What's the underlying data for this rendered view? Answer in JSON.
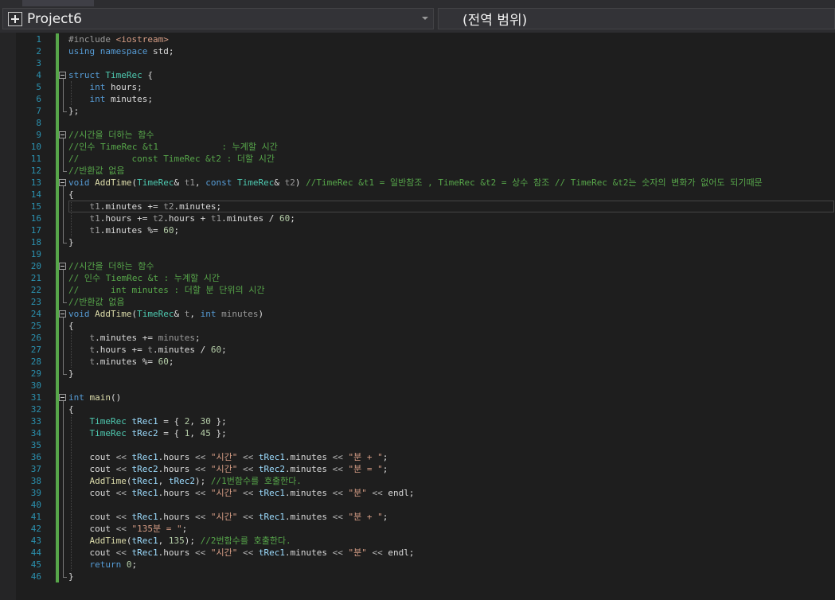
{
  "navbar": {
    "project": "Project6",
    "scope": "(전역 범위)"
  },
  "editor": {
    "caret_line": 15,
    "lines": [
      {
        "n": "1",
        "t": [
          [
            "pp",
            "#include "
          ],
          [
            "st",
            "<iostream>"
          ]
        ]
      },
      {
        "n": "2",
        "t": [
          [
            "kw",
            "using"
          ],
          [
            "",
            " "
          ],
          [
            "kw",
            "namespace"
          ],
          [
            "",
            " std;"
          ]
        ]
      },
      {
        "n": "3",
        "t": []
      },
      {
        "n": "4",
        "t": [
          [
            "kw",
            "struct"
          ],
          [
            "",
            " "
          ],
          [
            "ty",
            "TimeRec"
          ],
          [
            "",
            " {"
          ]
        ]
      },
      {
        "n": "5",
        "t": [
          [
            "",
            "    "
          ],
          [
            "kw",
            "int"
          ],
          [
            "",
            " "
          ],
          [
            "mb",
            "hours"
          ],
          [
            "",
            ";"
          ]
        ]
      },
      {
        "n": "6",
        "t": [
          [
            "",
            "    "
          ],
          [
            "kw",
            "int"
          ],
          [
            "",
            " "
          ],
          [
            "mb",
            "minutes"
          ],
          [
            "",
            ";"
          ]
        ]
      },
      {
        "n": "7",
        "t": [
          [
            "",
            "};"
          ]
        ]
      },
      {
        "n": "8",
        "t": []
      },
      {
        "n": "9",
        "t": [
          [
            "cm",
            "//시간을 더하는 함수"
          ]
        ]
      },
      {
        "n": "10",
        "t": [
          [
            "cm",
            "//인수 TimeRec &t1            : 누계할 시간"
          ]
        ]
      },
      {
        "n": "11",
        "t": [
          [
            "cm",
            "//          const TimeRec &t2 : 더할 시간"
          ]
        ]
      },
      {
        "n": "12",
        "t": [
          [
            "cm",
            "//반환값 없음"
          ]
        ]
      },
      {
        "n": "13",
        "t": [
          [
            "kw",
            "void"
          ],
          [
            "",
            " "
          ],
          [
            "fn",
            "AddTime"
          ],
          [
            "",
            "("
          ],
          [
            "ty",
            "TimeRec"
          ],
          [
            "",
            "& "
          ],
          [
            "pa",
            "t1"
          ],
          [
            "",
            ", "
          ],
          [
            "kw",
            "const"
          ],
          [
            "",
            " "
          ],
          [
            "ty",
            "TimeRec"
          ],
          [
            "",
            "& "
          ],
          [
            "pa",
            "t2"
          ],
          [
            "",
            ") "
          ],
          [
            "cm",
            "//TimeRec &t1 = 일반참조 , TimeRec &t2 = 상수 참조 // TimeRec &t2는 숫자의 변화가 없어도 되기때문"
          ]
        ]
      },
      {
        "n": "14",
        "t": [
          [
            "",
            "{"
          ]
        ]
      },
      {
        "n": "15",
        "t": [
          [
            "",
            "    "
          ],
          [
            "pa",
            "t1"
          ],
          [
            "",
            "."
          ],
          [
            "mb",
            "minutes"
          ],
          [
            "",
            " += "
          ],
          [
            "pa",
            "t2"
          ],
          [
            "",
            "."
          ],
          [
            "mb",
            "minutes"
          ],
          [
            "",
            ";"
          ]
        ]
      },
      {
        "n": "16",
        "t": [
          [
            "",
            "    "
          ],
          [
            "pa",
            "t1"
          ],
          [
            "",
            "."
          ],
          [
            "mb",
            "hours"
          ],
          [
            "",
            " += "
          ],
          [
            "pa",
            "t2"
          ],
          [
            "",
            "."
          ],
          [
            "mb",
            "hours"
          ],
          [
            "",
            " + "
          ],
          [
            "pa",
            "t1"
          ],
          [
            "",
            "."
          ],
          [
            "mb",
            "minutes"
          ],
          [
            "",
            " / "
          ],
          [
            "nu",
            "60"
          ],
          [
            "",
            ";"
          ]
        ]
      },
      {
        "n": "17",
        "t": [
          [
            "",
            "    "
          ],
          [
            "pa",
            "t1"
          ],
          [
            "",
            "."
          ],
          [
            "mb",
            "minutes"
          ],
          [
            "",
            " %= "
          ],
          [
            "nu",
            "60"
          ],
          [
            "",
            ";"
          ]
        ]
      },
      {
        "n": "18",
        "t": [
          [
            "",
            "}"
          ]
        ]
      },
      {
        "n": "19",
        "t": []
      },
      {
        "n": "20",
        "t": [
          [
            "cm",
            "//시간을 더하는 함수"
          ]
        ]
      },
      {
        "n": "21",
        "t": [
          [
            "cm",
            "// 인수 TiemRec &t : 누계할 시간"
          ]
        ]
      },
      {
        "n": "22",
        "t": [
          [
            "cm",
            "//      int minutes : 더할 분 단위의 시간"
          ]
        ]
      },
      {
        "n": "23",
        "t": [
          [
            "cm",
            "//반환값 없음"
          ]
        ]
      },
      {
        "n": "24",
        "t": [
          [
            "kw",
            "void"
          ],
          [
            "",
            " "
          ],
          [
            "fn",
            "AddTime"
          ],
          [
            "",
            "("
          ],
          [
            "ty",
            "TimeRec"
          ],
          [
            "",
            "& "
          ],
          [
            "pa",
            "t"
          ],
          [
            "",
            ", "
          ],
          [
            "kw",
            "int"
          ],
          [
            "",
            " "
          ],
          [
            "pa",
            "minutes"
          ],
          [
            "",
            ")"
          ]
        ]
      },
      {
        "n": "25",
        "t": [
          [
            "",
            "{"
          ]
        ]
      },
      {
        "n": "26",
        "t": [
          [
            "",
            "    "
          ],
          [
            "pa",
            "t"
          ],
          [
            "",
            "."
          ],
          [
            "mb",
            "minutes"
          ],
          [
            "",
            " += "
          ],
          [
            "pa",
            "minutes"
          ],
          [
            "",
            ";"
          ]
        ]
      },
      {
        "n": "27",
        "t": [
          [
            "",
            "    "
          ],
          [
            "pa",
            "t"
          ],
          [
            "",
            "."
          ],
          [
            "mb",
            "hours"
          ],
          [
            "",
            " += "
          ],
          [
            "pa",
            "t"
          ],
          [
            "",
            "."
          ],
          [
            "mb",
            "minutes"
          ],
          [
            "",
            " / "
          ],
          [
            "nu",
            "60"
          ],
          [
            "",
            ";"
          ]
        ]
      },
      {
        "n": "28",
        "t": [
          [
            "",
            "    "
          ],
          [
            "pa",
            "t"
          ],
          [
            "",
            "."
          ],
          [
            "mb",
            "minutes"
          ],
          [
            "",
            " %= "
          ],
          [
            "nu",
            "60"
          ],
          [
            "",
            ";"
          ]
        ]
      },
      {
        "n": "29",
        "t": [
          [
            "",
            "}"
          ]
        ]
      },
      {
        "n": "30",
        "t": []
      },
      {
        "n": "31",
        "t": [
          [
            "kw",
            "int"
          ],
          [
            "",
            " "
          ],
          [
            "fn",
            "main"
          ],
          [
            "",
            "()"
          ]
        ]
      },
      {
        "n": "32",
        "t": [
          [
            "",
            "{"
          ]
        ]
      },
      {
        "n": "33",
        "t": [
          [
            "",
            "    "
          ],
          [
            "ty",
            "TimeRec"
          ],
          [
            "",
            " "
          ],
          [
            "lv",
            "tRec1"
          ],
          [
            "",
            " = { "
          ],
          [
            "nu",
            "2"
          ],
          [
            "",
            ", "
          ],
          [
            "nu",
            "30"
          ],
          [
            "",
            " };"
          ]
        ]
      },
      {
        "n": "34",
        "t": [
          [
            "",
            "    "
          ],
          [
            "ty",
            "TimeRec"
          ],
          [
            "",
            " "
          ],
          [
            "lv",
            "tRec2"
          ],
          [
            "",
            " = { "
          ],
          [
            "nu",
            "1"
          ],
          [
            "",
            ", "
          ],
          [
            "nu",
            "45"
          ],
          [
            "",
            " };"
          ]
        ]
      },
      {
        "n": "35",
        "t": []
      },
      {
        "n": "36",
        "t": [
          [
            "",
            "    cout "
          ],
          [
            "op",
            "<<"
          ],
          [
            "",
            " "
          ],
          [
            "lv",
            "tRec1"
          ],
          [
            "",
            "."
          ],
          [
            "mb",
            "hours"
          ],
          [
            "",
            " "
          ],
          [
            "op",
            "<<"
          ],
          [
            "",
            " "
          ],
          [
            "st",
            "\"시간\""
          ],
          [
            "",
            " "
          ],
          [
            "op",
            "<<"
          ],
          [
            "",
            " "
          ],
          [
            "lv",
            "tRec1"
          ],
          [
            "",
            "."
          ],
          [
            "mb",
            "minutes"
          ],
          [
            "",
            " "
          ],
          [
            "op",
            "<<"
          ],
          [
            "",
            " "
          ],
          [
            "st",
            "\"분 + \""
          ],
          [
            "",
            ";"
          ]
        ]
      },
      {
        "n": "37",
        "t": [
          [
            "",
            "    cout "
          ],
          [
            "op",
            "<<"
          ],
          [
            "",
            " "
          ],
          [
            "lv",
            "tRec2"
          ],
          [
            "",
            "."
          ],
          [
            "mb",
            "hours"
          ],
          [
            "",
            " "
          ],
          [
            "op",
            "<<"
          ],
          [
            "",
            " "
          ],
          [
            "st",
            "\"시간\""
          ],
          [
            "",
            " "
          ],
          [
            "op",
            "<<"
          ],
          [
            "",
            " "
          ],
          [
            "lv",
            "tRec2"
          ],
          [
            "",
            "."
          ],
          [
            "mb",
            "minutes"
          ],
          [
            "",
            " "
          ],
          [
            "op",
            "<<"
          ],
          [
            "",
            " "
          ],
          [
            "st",
            "\"분 = \""
          ],
          [
            "",
            ";"
          ]
        ]
      },
      {
        "n": "38",
        "t": [
          [
            "",
            "    "
          ],
          [
            "fn",
            "AddTime"
          ],
          [
            "",
            "("
          ],
          [
            "lv",
            "tRec1"
          ],
          [
            "",
            ", "
          ],
          [
            "lv",
            "tRec2"
          ],
          [
            "",
            "); "
          ],
          [
            "cm",
            "//1번함수를 호출한다."
          ]
        ]
      },
      {
        "n": "39",
        "t": [
          [
            "",
            "    cout "
          ],
          [
            "op",
            "<<"
          ],
          [
            "",
            " "
          ],
          [
            "lv",
            "tRec1"
          ],
          [
            "",
            "."
          ],
          [
            "mb",
            "hours"
          ],
          [
            "",
            " "
          ],
          [
            "op",
            "<<"
          ],
          [
            "",
            " "
          ],
          [
            "st",
            "\"시간\""
          ],
          [
            "",
            " "
          ],
          [
            "op",
            "<<"
          ],
          [
            "",
            " "
          ],
          [
            "lv",
            "tRec1"
          ],
          [
            "",
            "."
          ],
          [
            "mb",
            "minutes"
          ],
          [
            "",
            " "
          ],
          [
            "op",
            "<<"
          ],
          [
            "",
            " "
          ],
          [
            "st",
            "\"분\""
          ],
          [
            "",
            " "
          ],
          [
            "op",
            "<<"
          ],
          [
            "",
            " endl;"
          ]
        ]
      },
      {
        "n": "40",
        "t": []
      },
      {
        "n": "41",
        "t": [
          [
            "",
            "    cout "
          ],
          [
            "op",
            "<<"
          ],
          [
            "",
            " "
          ],
          [
            "lv",
            "tRec1"
          ],
          [
            "",
            "."
          ],
          [
            "mb",
            "hours"
          ],
          [
            "",
            " "
          ],
          [
            "op",
            "<<"
          ],
          [
            "",
            " "
          ],
          [
            "st",
            "\"시간\""
          ],
          [
            "",
            " "
          ],
          [
            "op",
            "<<"
          ],
          [
            "",
            " "
          ],
          [
            "lv",
            "tRec1"
          ],
          [
            "",
            "."
          ],
          [
            "mb",
            "minutes"
          ],
          [
            "",
            " "
          ],
          [
            "op",
            "<<"
          ],
          [
            "",
            " "
          ],
          [
            "st",
            "\"분 + \""
          ],
          [
            "",
            ";"
          ]
        ]
      },
      {
        "n": "42",
        "t": [
          [
            "",
            "    cout "
          ],
          [
            "op",
            "<<"
          ],
          [
            "",
            " "
          ],
          [
            "st",
            "\"135분 = \""
          ],
          [
            "",
            ";"
          ]
        ]
      },
      {
        "n": "43",
        "t": [
          [
            "",
            "    "
          ],
          [
            "fn",
            "AddTime"
          ],
          [
            "",
            "("
          ],
          [
            "lv",
            "tRec1"
          ],
          [
            "",
            ", "
          ],
          [
            "nu",
            "135"
          ],
          [
            "",
            "); "
          ],
          [
            "cm",
            "//2번함수를 호출한다."
          ]
        ]
      },
      {
        "n": "44",
        "t": [
          [
            "",
            "    cout "
          ],
          [
            "op",
            "<<"
          ],
          [
            "",
            " "
          ],
          [
            "lv",
            "tRec1"
          ],
          [
            "",
            "."
          ],
          [
            "mb",
            "hours"
          ],
          [
            "",
            " "
          ],
          [
            "op",
            "<<"
          ],
          [
            "",
            " "
          ],
          [
            "st",
            "\"시간\""
          ],
          [
            "",
            " "
          ],
          [
            "op",
            "<<"
          ],
          [
            "",
            " "
          ],
          [
            "lv",
            "tRec1"
          ],
          [
            "",
            "."
          ],
          [
            "mb",
            "minutes"
          ],
          [
            "",
            " "
          ],
          [
            "op",
            "<<"
          ],
          [
            "",
            " "
          ],
          [
            "st",
            "\"분\""
          ],
          [
            "",
            " "
          ],
          [
            "op",
            "<<"
          ],
          [
            "",
            " endl;"
          ]
        ]
      },
      {
        "n": "45",
        "t": [
          [
            "",
            "    "
          ],
          [
            "kw",
            "return"
          ],
          [
            "",
            " "
          ],
          [
            "nu",
            "0"
          ],
          [
            "",
            ";"
          ]
        ]
      },
      {
        "n": "46",
        "t": [
          [
            "",
            "}"
          ]
        ]
      }
    ]
  }
}
